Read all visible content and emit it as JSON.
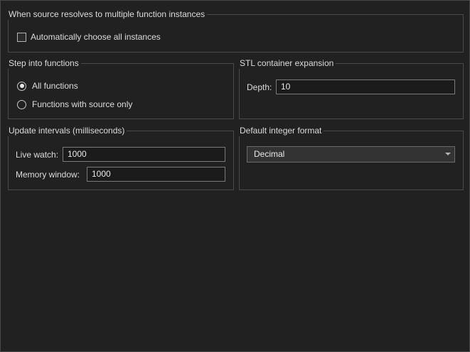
{
  "instances_group": {
    "title": "When source resolves to multiple function instances",
    "auto_choose_label": "Automatically choose all instances",
    "auto_choose_checked": false
  },
  "step_into_group": {
    "title": "Step into functions",
    "options": [
      {
        "label": "All functions",
        "selected": true
      },
      {
        "label": "Functions with source only",
        "selected": false
      }
    ]
  },
  "stl_group": {
    "title": "STL container expansion",
    "depth_label": "Depth:",
    "depth_value": "10"
  },
  "update_group": {
    "title": "Update intervals (milliseconds)",
    "live_watch_label": "Live watch:",
    "live_watch_value": "1000",
    "memory_window_label": "Memory window:",
    "memory_window_value": "1000"
  },
  "integer_format_group": {
    "title": "Default integer format",
    "selected": "Decimal"
  }
}
